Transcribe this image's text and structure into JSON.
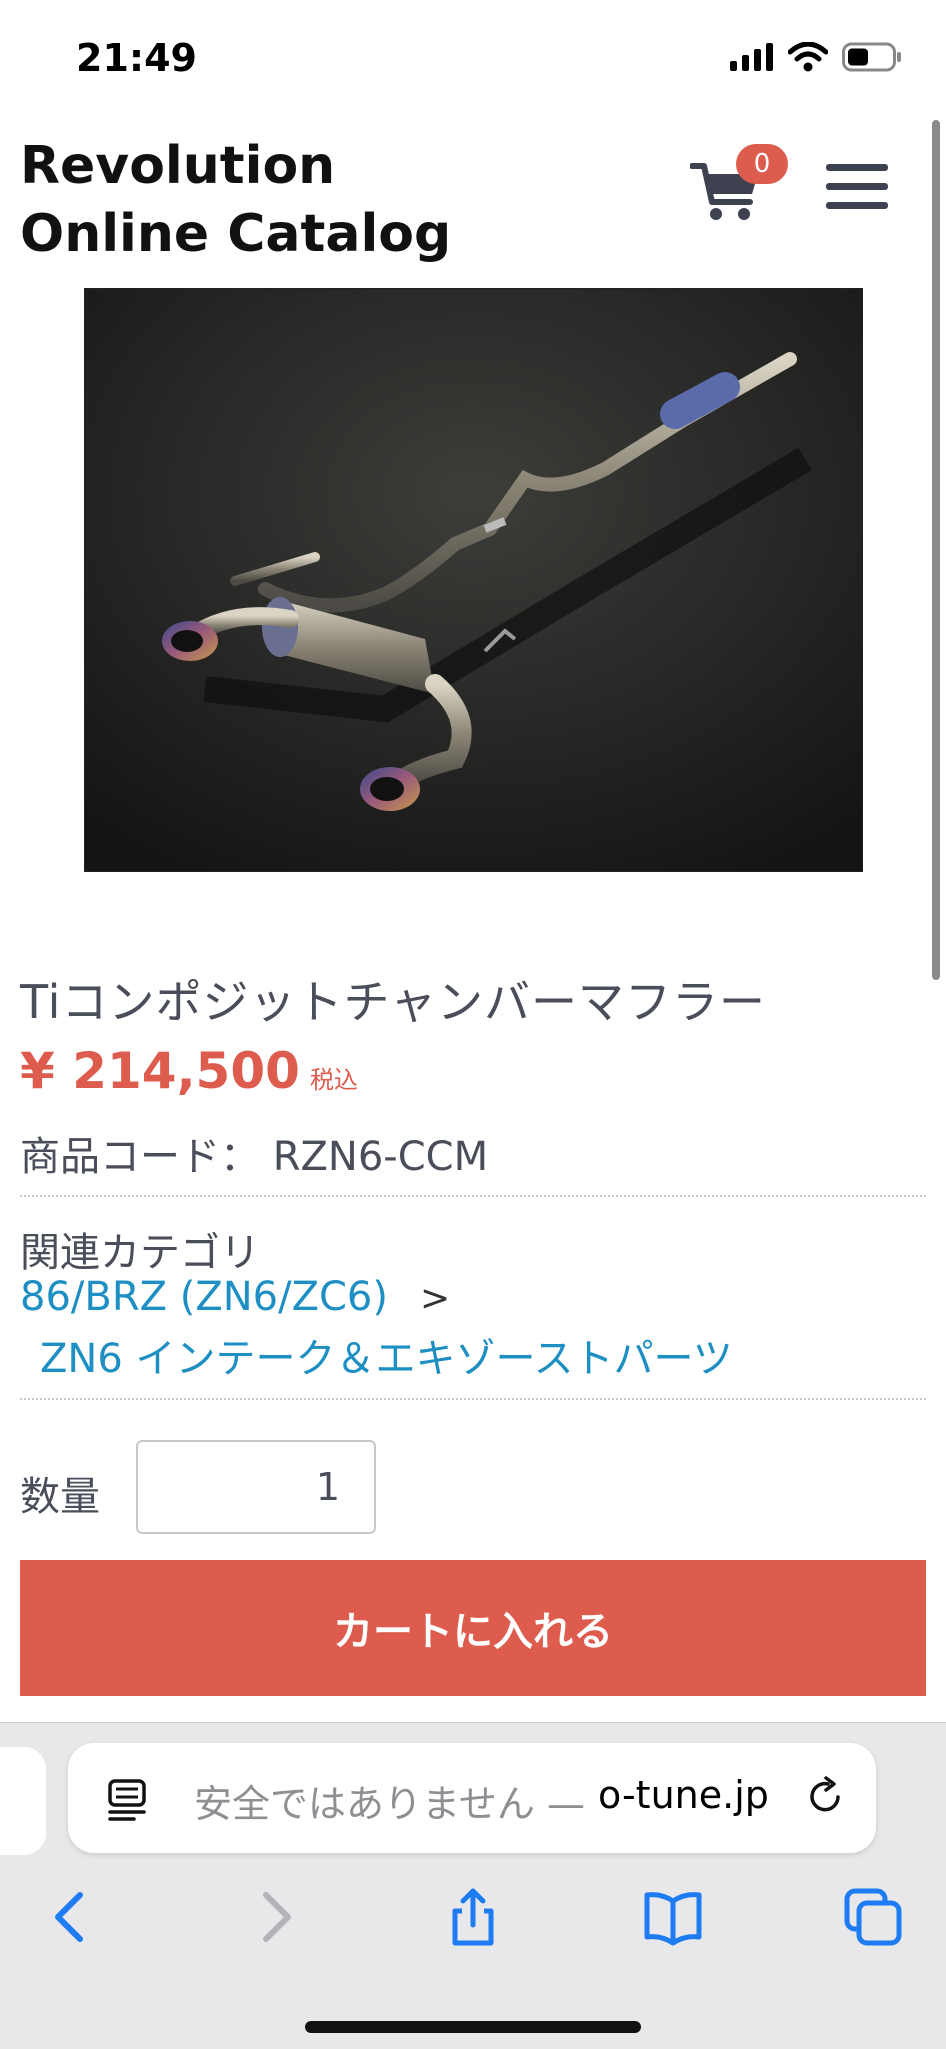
{
  "status_bar": {
    "time": "21:49"
  },
  "header": {
    "title": "Revolution Online Catalog",
    "cart_count": "0"
  },
  "product": {
    "name": "Tiコンポジットチャンバーマフラー",
    "price": "¥ 214,500",
    "tax_note": "税込",
    "code_label": "商品コード：",
    "code_value": "RZN6-CCM",
    "category_label": "関連カテゴリ",
    "category_link_1": "86/BRZ (ZN6/ZC6)",
    "category_separator": ">",
    "category_link_2": "ZN6 インテーク＆エキゾーストパーツ",
    "quantity_label": "数量",
    "quantity_value": "1",
    "add_to_cart_label": "カートに入れる"
  },
  "browser": {
    "address_text_security": "安全ではありません — ",
    "address_text_host": "o-tune.jp"
  },
  "colors": {
    "accent_red": "#de5c4e",
    "link_blue": "#1e8fc3",
    "ios_blue": "#1e7cf2"
  },
  "icons": [
    "signal-icon",
    "wifi-icon",
    "battery-icon",
    "cart-icon",
    "hamburger-menu-icon",
    "reader-icon",
    "reload-icon",
    "back-icon",
    "forward-icon",
    "share-icon",
    "bookmarks-icon",
    "tabs-icon"
  ]
}
